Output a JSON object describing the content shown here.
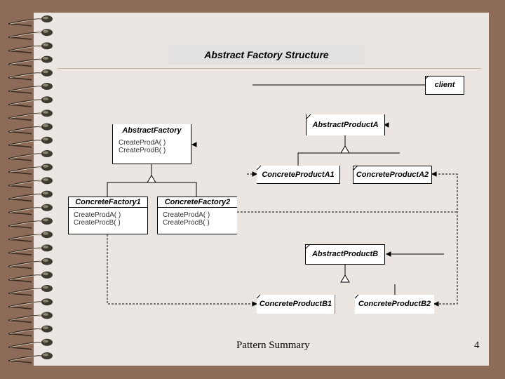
{
  "slide": {
    "title": "Abstract Factory Structure",
    "footer": "Pattern Summary",
    "page_number": "4"
  },
  "diagram": {
    "client": {
      "name": "client"
    },
    "abstract_factory": {
      "name": "AbstractFactory",
      "operations": [
        "CreateProdA( )",
        "CreateProdB( )"
      ]
    },
    "concrete_factory_1": {
      "name": "ConcreteFactory1",
      "operations": [
        "CreateProdA( )",
        "CreateProcB( )"
      ]
    },
    "concrete_factory_2": {
      "name": "ConcreteFactory2",
      "operations": [
        "CreateProdA( )",
        "CreateProcB( )"
      ]
    },
    "abstract_product_a": {
      "name": "AbstractProductA"
    },
    "concrete_product_a1": {
      "name": "ConcreteProductA1"
    },
    "concrete_product_a2": {
      "name": "ConcreteProductA2"
    },
    "abstract_product_b": {
      "name": "AbstractProductB"
    },
    "concrete_product_b1": {
      "name": "ConcreteProductB1"
    },
    "concrete_product_b2": {
      "name": "ConcreteProductB2"
    }
  },
  "colors": {
    "background": "#8c6c58",
    "page": "#ebe6e2",
    "rule": "#c8b89c"
  }
}
